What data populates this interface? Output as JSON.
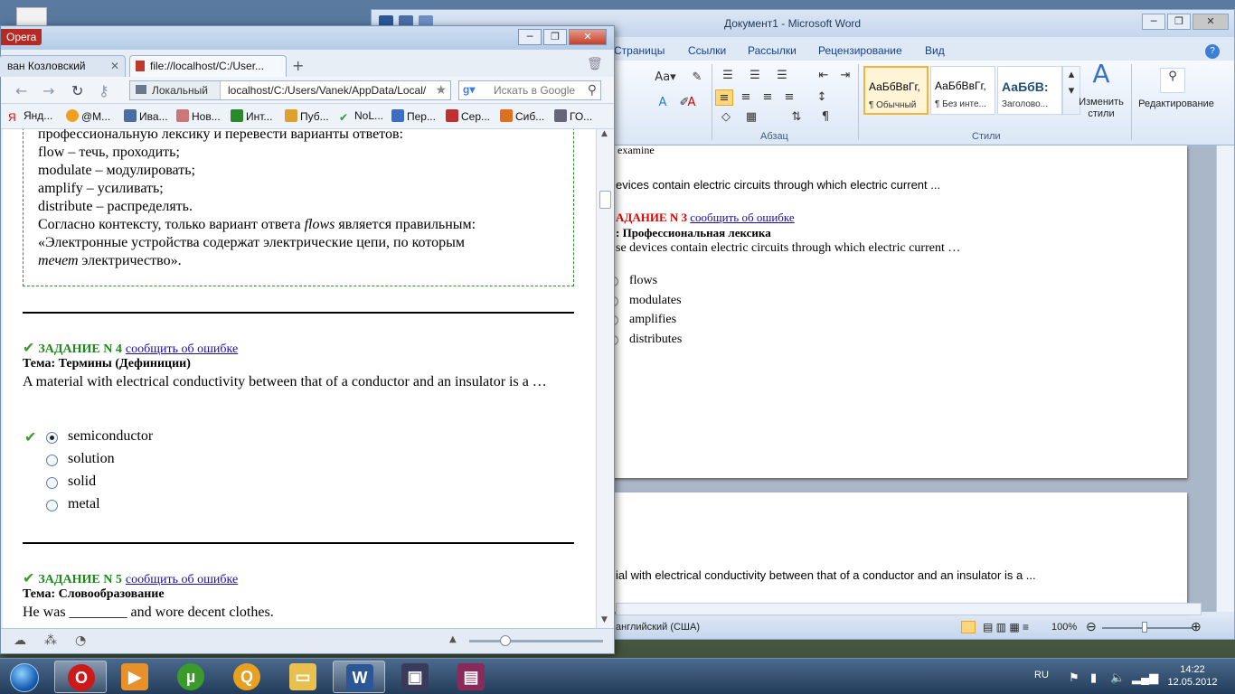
{
  "word": {
    "title": "Документ1 - Microsoft Word",
    "tabs": [
      "Страницы",
      "Ссылки",
      "Рассылки",
      "Рецензирование",
      "Вид"
    ],
    "groups": {
      "paragraph": "Абзац",
      "styles": "Стили"
    },
    "styles": [
      {
        "sample": "АаБбВвГг,",
        "name": "¶ Обычный"
      },
      {
        "sample": "АаБбВвГг,",
        "name": "¶ Без инте..."
      },
      {
        "sample": "АаБбВ:",
        "name": "Заголово..."
      }
    ],
    "change_styles": "Изменить стили",
    "editing": "Редактирование",
    "doc": {
      "line_examine": "examine",
      "line_devices": "evices contain electric circuits through which electric current ...",
      "task_label": "АДАНИЕ N 3",
      "report_link": "сообщить об ошибке",
      "topic": ": Профессиональная лексика",
      "question": "se devices contain electric circuits through which electric current …",
      "options": [
        "flows",
        "modulates",
        "amplifies",
        "distributes"
      ],
      "page2_line": "ial with electrical conductivity between that of a conductor and an insulator is a ..."
    },
    "status": {
      "language": "английский (США)",
      "zoom": "100%"
    }
  },
  "opera": {
    "menu": "Opera",
    "tabs": [
      {
        "label": "ван Козловский"
      },
      {
        "label": "file://localhost/C:/User..."
      }
    ],
    "address": {
      "badge": "Локальный",
      "url": "localhost/C:/Users/Vanek/AppData/Local/"
    },
    "search_placeholder": "Искать в Google",
    "bookmarks": [
      "Янд...",
      "@М...",
      "Ива...",
      "Нов...",
      "Инт...",
      "Пуб...",
      "NoL...",
      "Пер...",
      "Сер...",
      "Сиб...",
      "ГО..."
    ],
    "explanation": [
      "профессиональную лексику и перевести варианты ответов:",
      "flow – течь, проходить;",
      "modulate – модулировать;",
      "amplify – усиливать;",
      "distribute – распределять."
    ],
    "explanation_tail": {
      "pre": "Согласно контексту, только вариант ответа ",
      "word": "flows",
      "post": " является правильным:",
      "line2": "«Электронные устройства содержат электрические цепи, по которым",
      "italic": "течет",
      "line3_post": " электричество»."
    },
    "task4": {
      "label": "ЗАДАНИЕ N 4",
      "link": "сообщить об ошибке",
      "topic": "Тема: Термины (Дефиниции)",
      "question": "A material with electrical conductivity between that of a conductor and an insulator is a …",
      "options": [
        "semiconductor",
        "solution",
        "solid",
        "metal"
      ]
    },
    "task5": {
      "label": "ЗАДАНИЕ N 5",
      "link": "сообщить об ошибке",
      "topic": "Тема: Словообразование",
      "question": "He was ________ and wore decent clothes."
    }
  },
  "taskbar": {
    "lang": "RU",
    "time": "14:22",
    "date": "12.05.2012"
  }
}
